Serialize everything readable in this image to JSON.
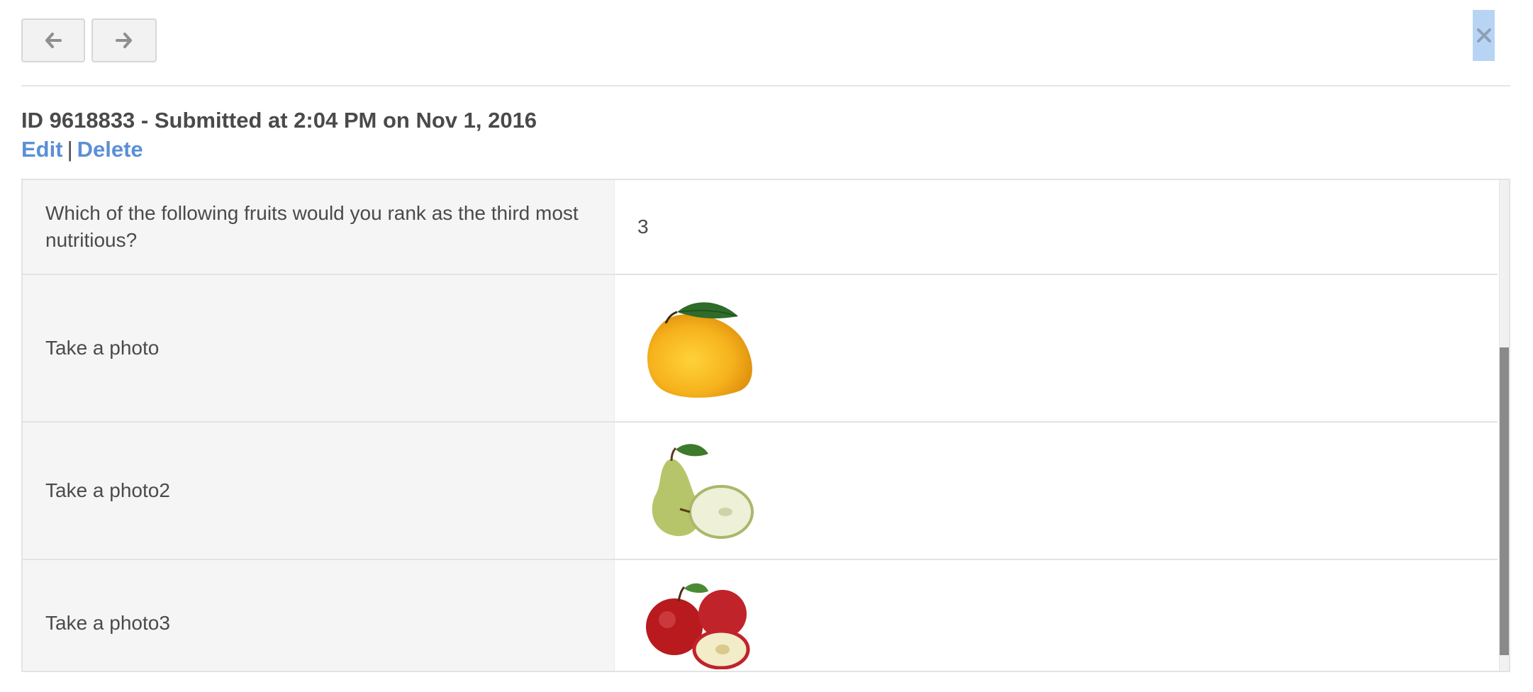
{
  "nav": {
    "prev_icon": "arrow-left-icon",
    "next_icon": "arrow-right-icon",
    "close_icon": "close-icon"
  },
  "header": {
    "title": "ID 9618833 - Submitted at 2:04 PM on Nov 1, 2016",
    "edit_label": "Edit",
    "separator": "|",
    "delete_label": "Delete"
  },
  "rows": [
    {
      "question": "Which of the following fruits would you rank as the third most nutritious?",
      "answer": "3"
    },
    {
      "question": "Take a photo",
      "answer_image": "mango-photo"
    },
    {
      "question": "Take a photo2",
      "answer_image": "pear-photo"
    },
    {
      "question": "Take a photo3",
      "answer_image": "apples-photo"
    }
  ],
  "colors": {
    "link": "#5b8fd6",
    "text": "#4a4a4a",
    "close_highlight": "#b8d4f5"
  }
}
